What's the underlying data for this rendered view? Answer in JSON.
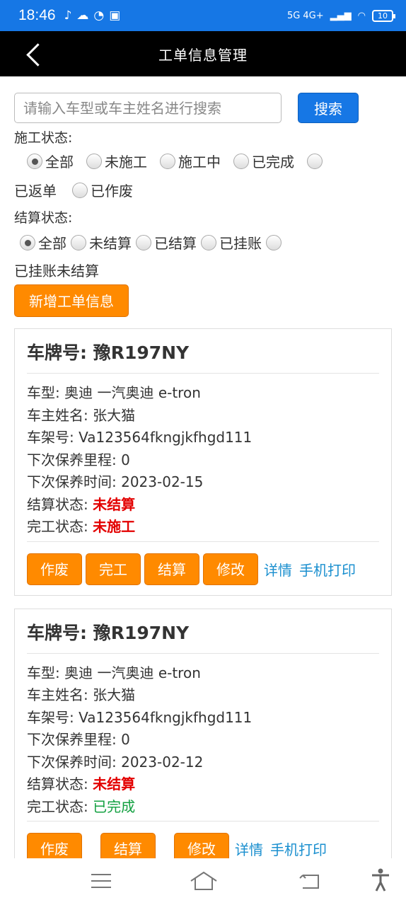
{
  "status_bar": {
    "time": "18:46",
    "icons": [
      "tiktok-icon",
      "cloud-icon",
      "compass-icon",
      "app-icon"
    ],
    "network": "5G 4G+",
    "battery": "10"
  },
  "header": {
    "title": "工单信息管理"
  },
  "search": {
    "placeholder": "请输入车型或车主姓名进行搜索",
    "button": "搜索"
  },
  "work_status": {
    "label": "施工状态:",
    "options": [
      "全部",
      "未施工",
      "施工中",
      "已完成",
      "已返单",
      "已作废"
    ],
    "selected": "全部"
  },
  "settle_status": {
    "label": "结算状态:",
    "options": [
      "全部",
      "未结算",
      "已结算",
      "已挂账",
      "已挂账未结算"
    ],
    "selected": "全部"
  },
  "add_button": "新增工单信息",
  "labels": {
    "plate": "车牌号: ",
    "model": "车型: ",
    "owner": "车主姓名: ",
    "vin": "车架号: ",
    "mileage": "下次保养里程: ",
    "next_time": "下次保养时间: ",
    "settle": "结算状态: ",
    "finish": "完工状态: "
  },
  "cards": [
    {
      "plate": "豫R197NY",
      "model": "奥迪 一汽奥迪 e-tron",
      "owner": "张大猫",
      "vin": "Va123564fkngjkfhgd111",
      "mileage": "0",
      "next_time": "2023-02-15",
      "settle": "未结算",
      "finish": "未施工",
      "actions": [
        "作废",
        "完工",
        "结算",
        "修改"
      ],
      "links": [
        "详情",
        "手机打印"
      ]
    },
    {
      "plate": "豫R197NY",
      "model": "奥迪 一汽奥迪 e-tron",
      "owner": "张大猫",
      "vin": "Va123564fkngjkfhgd111",
      "mileage": "0",
      "next_time": "2023-02-12",
      "settle": "未结算",
      "finish": "已完成",
      "actions": [
        "作废",
        "结算",
        "修改"
      ],
      "links": [
        "详情",
        "手机打印"
      ]
    }
  ],
  "colors": {
    "primary": "#1677e5",
    "accent": "#ff8a00",
    "danger": "#e30000",
    "success": "#12a040",
    "link": "#1a8fcf"
  }
}
